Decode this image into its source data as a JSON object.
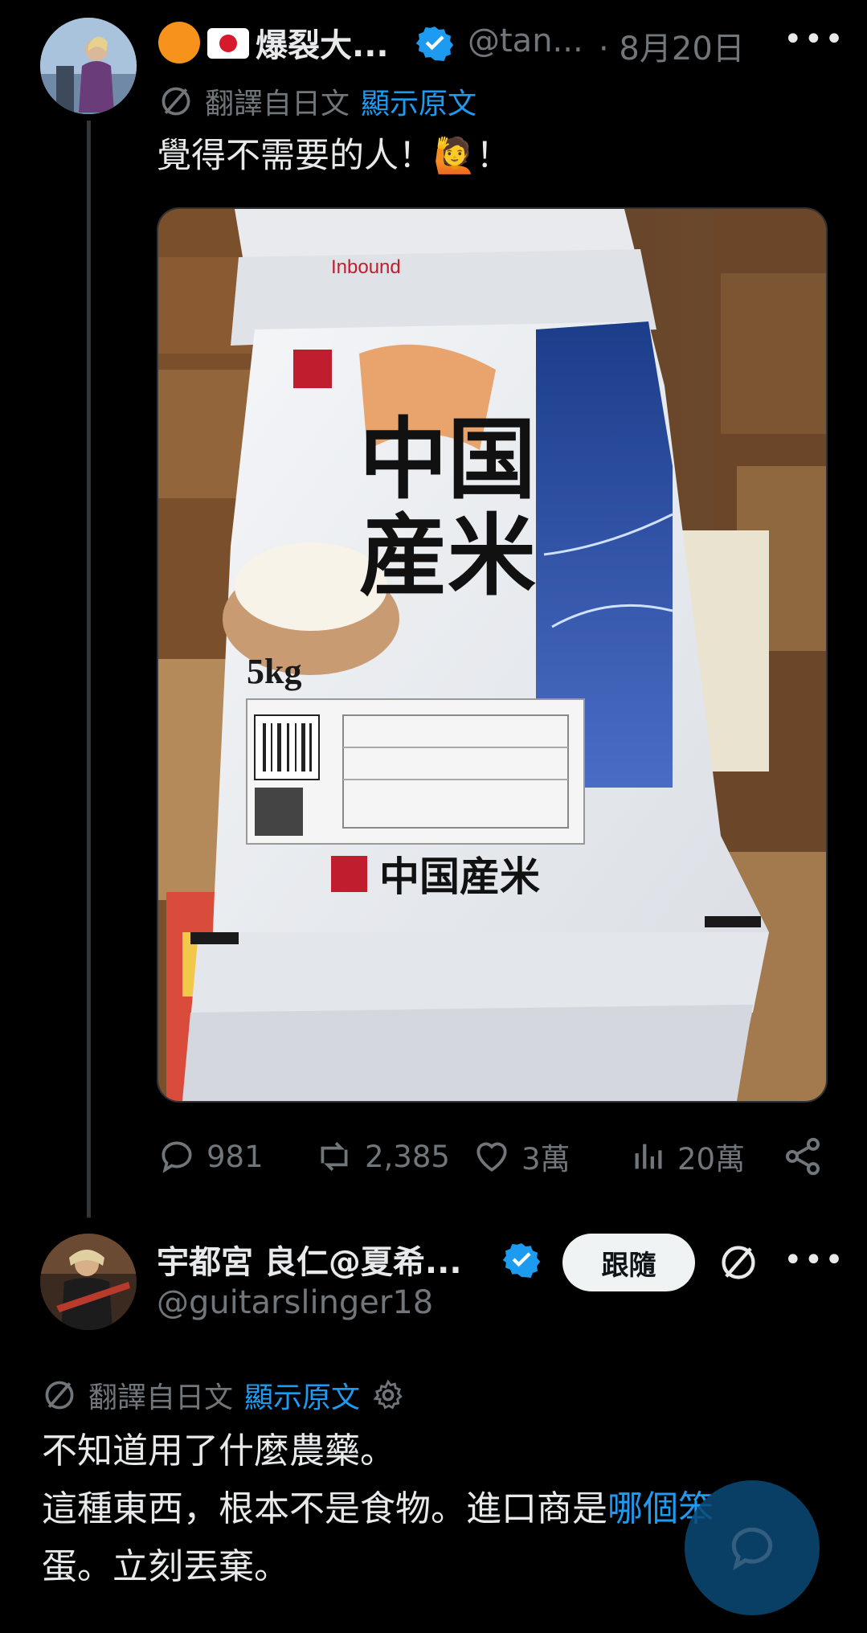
{
  "colors": {
    "accent": "#1d9bf0",
    "muted": "#71767b",
    "text": "#e7e9ea",
    "background": "#000000"
  },
  "tweet1": {
    "display_name": "爆裂大...",
    "handle": "@tan...",
    "date": "· 8月20日",
    "more_icon": "more-dots-icon",
    "translated_from": "翻譯自日文",
    "show_original": "顯示原文",
    "text_before_emoji": "覺得不需要的人！",
    "emoji": "🙋",
    "text_after_emoji": "！",
    "media": {
      "top_logo": "Inbound",
      "title_line1": "中国",
      "title_line2": "産米",
      "weight": "5kg",
      "bottom_label": "中国産米"
    },
    "stats": {
      "replies": "981",
      "retweets": "2,385",
      "likes": "3萬",
      "views": "20萬"
    }
  },
  "tweet2": {
    "display_name": "宇都宮 良仁@夏希...",
    "handle": "@guitarslinger18",
    "follow_label": "跟隨",
    "translated_from": "翻譯自日文",
    "show_original": "顯示原文",
    "text_line1": "不知道用了什麼農藥。",
    "text_line2_plain": "這種東西，根本不是食物。進口商是",
    "text_line2_highlight": "哪個笨",
    "text_line3": "蛋。立刻丟棄。"
  }
}
